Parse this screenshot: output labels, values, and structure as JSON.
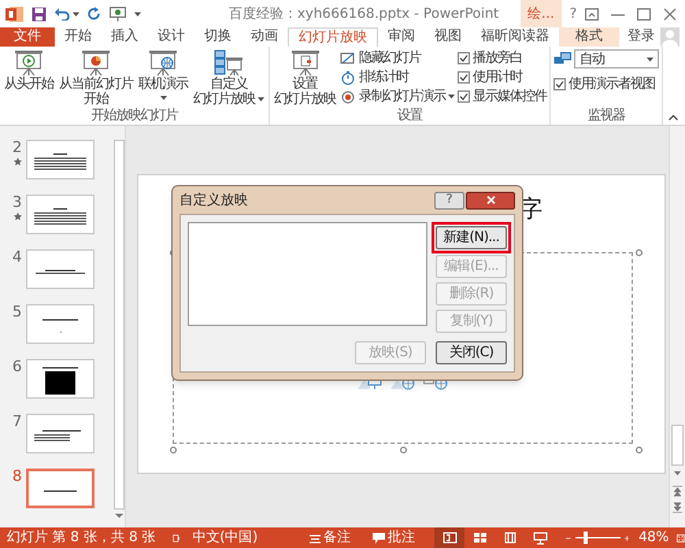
{
  "title_bar": {
    "title": "百度经验：xyh666168.pptx - PowerPoint",
    "context_label": "绘...",
    "help": "?"
  },
  "tabs": [
    {
      "label": "文件",
      "kind": "file",
      "selected": false
    },
    {
      "label": "开始",
      "kind": "normal",
      "selected": false
    },
    {
      "label": "插入",
      "kind": "normal",
      "selected": false
    },
    {
      "label": "设计",
      "kind": "normal",
      "selected": false
    },
    {
      "label": "切换",
      "kind": "normal",
      "selected": false
    },
    {
      "label": "动画",
      "kind": "normal",
      "selected": false
    },
    {
      "label": "幻灯片放映",
      "kind": "normal",
      "selected": true
    },
    {
      "label": "审阅",
      "kind": "normal",
      "selected": false
    },
    {
      "label": "视图",
      "kind": "normal",
      "selected": false
    },
    {
      "label": "福昕阅读器",
      "kind": "normal",
      "selected": false
    },
    {
      "label": "格式",
      "kind": "context",
      "selected": false
    }
  ],
  "account": {
    "sign_in": "登录"
  },
  "ribbon": {
    "groups": [
      {
        "label": "开始放映幻灯片",
        "items": [
          {
            "kind": "large",
            "lines": [
              "从头开始"
            ],
            "dropdown": false
          },
          {
            "kind": "large",
            "lines": [
              "从当前幻灯片",
              "开始"
            ],
            "dropdown": false
          },
          {
            "kind": "large",
            "lines": [
              "联机演示"
            ],
            "dropdown": true
          },
          {
            "kind": "large",
            "lines": [
              "自定义",
              "幻灯片放映"
            ],
            "dropdown": true
          }
        ]
      },
      {
        "label": "设置",
        "items": [
          {
            "kind": "large",
            "lines": [
              "设置",
              "幻灯片放映"
            ],
            "dropdown": false
          },
          {
            "kind": "small-stack",
            "entries": [
              {
                "label": "隐藏幻灯片",
                "dropdown": false
              },
              {
                "label": "排练计时",
                "dropdown": false
              },
              {
                "label": "录制幻灯片演示",
                "dropdown": true
              }
            ]
          },
          {
            "kind": "check-stack",
            "entries": [
              {
                "label": "播放旁白",
                "checked": true
              },
              {
                "label": "使用计时",
                "checked": true
              },
              {
                "label": "显示媒体控件",
                "checked": true
              }
            ]
          }
        ]
      },
      {
        "label": "监视器",
        "items": [
          {
            "kind": "monitor-panel",
            "value": "自动",
            "entries": [
              {
                "label": "使用演示者视图",
                "checked": true
              }
            ]
          }
        ]
      }
    ]
  },
  "thumbnails": [
    {
      "number": "2",
      "animated": true,
      "selected": false,
      "kind": "text"
    },
    {
      "number": "3",
      "animated": true,
      "selected": false,
      "kind": "text"
    },
    {
      "number": "4",
      "animated": false,
      "selected": false,
      "kind": "title-lines"
    },
    {
      "number": "5",
      "animated": false,
      "selected": false,
      "kind": "title-dot"
    },
    {
      "number": "6",
      "animated": false,
      "selected": false,
      "kind": "title-image"
    },
    {
      "number": "7",
      "animated": false,
      "selected": false,
      "kind": "bullets"
    },
    {
      "number": "8",
      "animated": false,
      "selected": true,
      "kind": "title"
    }
  ],
  "slide": {
    "title_fragment": "字"
  },
  "dialog": {
    "title": "自定义放映",
    "help": "?",
    "side_buttons": [
      {
        "label": "新建(N)...",
        "disabled": false,
        "highlighted": true
      },
      {
        "label": "编辑(E)...",
        "disabled": true,
        "highlighted": false
      },
      {
        "label": "删除(R)",
        "disabled": true,
        "highlighted": false
      },
      {
        "label": "复制(Y)",
        "disabled": true,
        "highlighted": false
      }
    ],
    "bottom_buttons": [
      {
        "label": "放映(S)",
        "disabled": true
      },
      {
        "label": "关闭(C)",
        "disabled": false
      }
    ]
  },
  "status_bar": {
    "slide_info": "幻灯片 第 8 张，共 8 张",
    "language": "中文(中国)",
    "notes": "备注",
    "comments": "批注",
    "views": [
      {
        "selected": true
      },
      {
        "selected": false
      },
      {
        "selected": false
      },
      {
        "selected": false
      }
    ],
    "zoom": {
      "level": 0.22,
      "reading": "48%"
    }
  }
}
